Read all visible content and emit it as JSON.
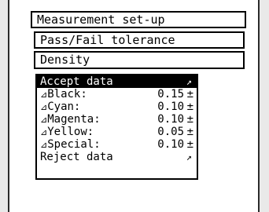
{
  "menu_path": {
    "level1": "Measurement set-up",
    "level2": "Pass/Fail tolerance",
    "level3": "Density"
  },
  "submenu": {
    "accept": {
      "label": "Accept data",
      "arrow": "↗"
    },
    "items": [
      {
        "delta": "⊿",
        "label": "Black:",
        "value": "0.15",
        "pm": "±"
      },
      {
        "delta": "⊿",
        "label": "Cyan:",
        "value": "0.10",
        "pm": "±"
      },
      {
        "delta": "⊿",
        "label": "Magenta:",
        "value": "0.10",
        "pm": "±"
      },
      {
        "delta": "⊿",
        "label": "Yellow:",
        "value": "0.05",
        "pm": "±"
      },
      {
        "delta": "⊿",
        "label": "Special:",
        "value": "0.10",
        "pm": "±"
      }
    ],
    "reject": {
      "label": "Reject data",
      "arrow": "↗"
    }
  },
  "colors": {
    "screen": "#ffffff",
    "ink": "#000000",
    "bezel": "#e9e9e9"
  }
}
